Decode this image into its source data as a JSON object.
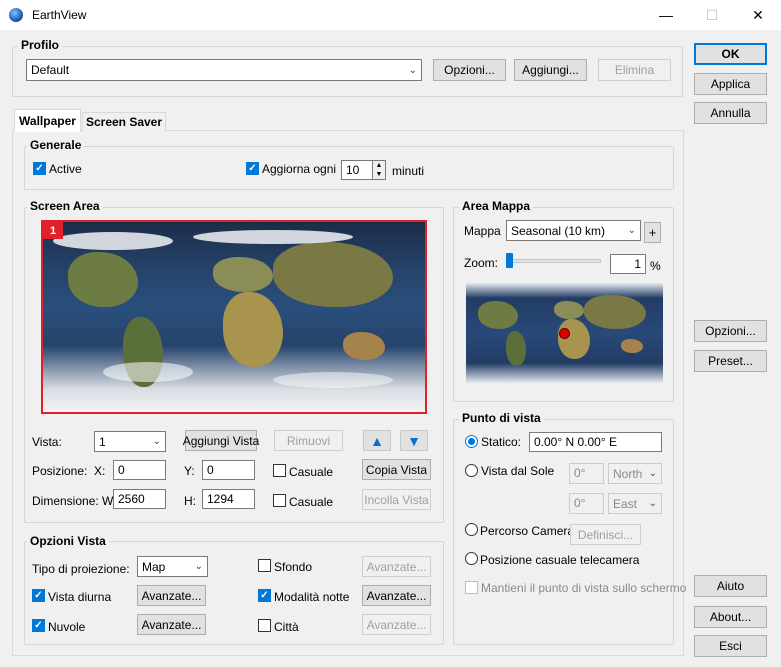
{
  "window": {
    "title": "EarthView",
    "minimize": "—",
    "maximize": "☐",
    "close": "✕"
  },
  "profilo": {
    "label": "Profilo",
    "selected": "Default",
    "opzioni": "Opzioni...",
    "aggiungi": "Aggiungi...",
    "elimina": "Elimina"
  },
  "right_buttons": {
    "ok": "OK",
    "applica": "Applica",
    "annulla": "Annulla",
    "opzioni": "Opzioni...",
    "preset": "Preset...",
    "aiuto": "Aiuto",
    "about": "About...",
    "esci": "Esci"
  },
  "tabs": [
    {
      "label": "Wallpaper",
      "active": true
    },
    {
      "label": "Screen Saver",
      "active": false
    }
  ],
  "generale": {
    "label": "Generale",
    "active_label": "Active",
    "active_checked": true,
    "aggiorna_label": "Aggiorna ogni",
    "aggiorna_checked": true,
    "aggiorna_value": "10",
    "minuti": "minuti"
  },
  "screen_area": {
    "label": "Screen Area",
    "monitor_number": "1",
    "vista_label": "Vista:",
    "vista_value": "1",
    "aggiungi_vista": "Aggiungi Vista",
    "rimuovi": "Rimuovi",
    "posizione_label": "Posizione:",
    "x_label": "X:",
    "x_value": "0",
    "y_label": "Y:",
    "y_value": "0",
    "casuale1": "Casuale",
    "copia_vista": "Copia Vista",
    "dimensione_label": "Dimensione: W:",
    "w_value": "2560",
    "h_label": "H:",
    "h_value": "1294",
    "casuale2": "Casuale",
    "incolla_vista": "Incolla Vista"
  },
  "area_mappa": {
    "label": "Area Mappa",
    "mappa_label": "Mappa",
    "mappa_value": "Seasonal (10 km)",
    "plus": "+",
    "zoom_label": "Zoom:",
    "zoom_value": "1",
    "zoom_unit": "%",
    "zoom_level": 0
  },
  "punto_di_vista": {
    "label": "Punto di vista",
    "statico_label": "Statico:",
    "statico_value": "0.00° N  0.00° E",
    "vista_sole_label": "Vista dal Sole",
    "lat_value": "0°",
    "lat_dir": "North",
    "lon_value": "0°",
    "lon_dir": "East",
    "percorso_label": "Percorso Camera",
    "definisci": "Definisci...",
    "casuale_label": "Posizione casuale telecamera",
    "mantieni_label": "Mantieni il punto di vista sullo schermo"
  },
  "opzioni_vista": {
    "label": "Opzioni Vista",
    "tipo_label": "Tipo di proiezione:",
    "tipo_value": "Map",
    "sfondo": "Sfondo",
    "avanzate_sfondo": "Avanzate...",
    "vista_diurna": "Vista diurna",
    "avanzate_diurna": "Avanzate...",
    "modalita_notte": "Modalità notte",
    "avanzate_notte": "Avanzate...",
    "nuvole": "Nuvole",
    "avanzate_nuvole": "Avanzate...",
    "citta": "Città",
    "avanzate_citta": "Avanzate..."
  },
  "icons": {
    "dropdown": "chevron-down-icon",
    "up": "arrow-up-icon",
    "down": "arrow-down-icon"
  },
  "colors": {
    "accent": "#0078d7",
    "selection_border": "#e0202a",
    "marker": "#e00000"
  }
}
